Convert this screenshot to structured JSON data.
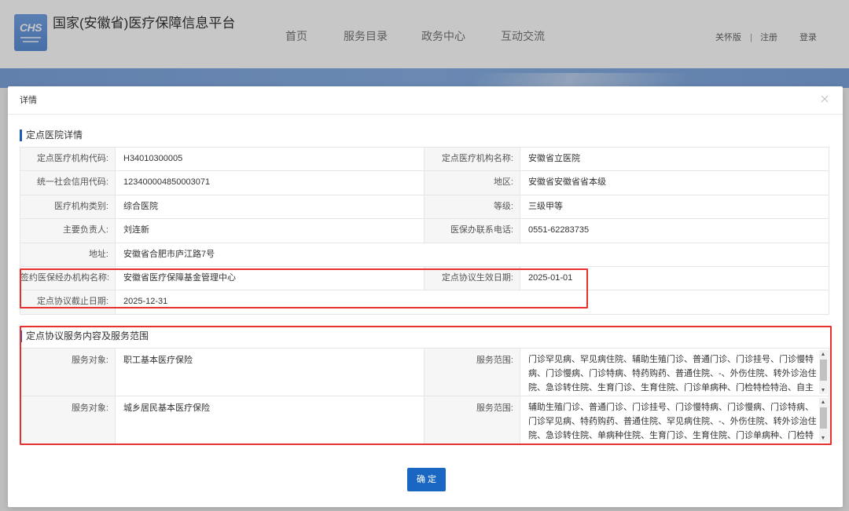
{
  "header": {
    "logo": {
      "text": "CHS"
    },
    "title": "国家(安徽省)医疗保障信息平台",
    "nav": [
      {
        "label": "首页"
      },
      {
        "label": "服务目录"
      },
      {
        "label": "政务中心"
      },
      {
        "label": "互动交流"
      }
    ],
    "links": {
      "care_mode": "关怀版",
      "divider": "|",
      "register": "注册",
      "login": "登录"
    }
  },
  "modal": {
    "title": "详情",
    "detail_section": {
      "title": "定点医院详情",
      "rows": [
        {
          "label1": "定点医疗机构代码:",
          "value1": "H34010300005",
          "label2": "定点医疗机构名称:",
          "value2": "安徽省立医院"
        },
        {
          "label1": "统一社会信用代码:",
          "value1": "123400004850003071",
          "label2": "地区:",
          "value2": "安徽省安徽省省本级"
        },
        {
          "label1": "医疗机构类别:",
          "value1": "综合医院",
          "label2": "等级:",
          "value2": "三级甲等"
        },
        {
          "label1": "主要负责人:",
          "value1": "刘连新",
          "label2": "医保办联系电话:",
          "value2": "0551-62283735"
        },
        {
          "label1": "地址:",
          "value1": "安徽省合肥市庐江路7号"
        },
        {
          "label1": "签约医保经办机构名称:",
          "value1": "安徽省医疗保障基金管理中心",
          "label2": "定点协议生效日期:",
          "value2": "2025-01-01"
        },
        {
          "label1": "定点协议截止日期:",
          "value1": "2025-12-31"
        }
      ]
    },
    "service_section": {
      "title": "定点协议服务内容及服务范围",
      "rows": [
        {
          "object_label": "服务对象:",
          "object_value": "职工基本医疗保险",
          "scope_label": "服务范围:",
          "scope_value": "门诊罕见病、罕见病住院、辅助生殖门诊、普通门诊、门诊挂号、门诊慢特病、门诊慢病、门诊特病、特药购药、普通住院、-、外伤住院、转外诊治住院、急诊转住院、生育门诊、生育住院、门诊单病种、门检特检特治、自主"
        },
        {
          "object_label": "服务对象:",
          "object_value": "城乡居民基本医疗保险",
          "scope_label": "服务范围:",
          "scope_value": "辅助生殖门诊、普通门诊、门诊挂号、门诊慢特病、门诊慢病、门诊特病、门诊罕见病、特药购药、普通住院、罕见病住院、-、外伤住院、转外诊治住院、急诊转住院、单病种住院、生育门诊、生育住院、门诊单病种、门检特"
        }
      ]
    },
    "confirm_label": "确 定"
  },
  "colors": {
    "section_marker": "#1e5bb6",
    "confirm_button": "#1967c3",
    "highlight": "#e8312f",
    "logo": "#5b8fd6"
  },
  "icons": {
    "logo": "chs-logo-icon",
    "close": "close-icon",
    "section_marker": "section-bar-icon",
    "scroll_up": "scroll-up-arrow-icon",
    "scroll_down": "scroll-down-arrow-icon"
  }
}
